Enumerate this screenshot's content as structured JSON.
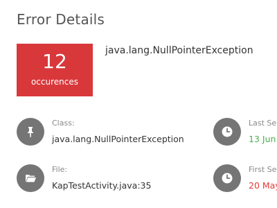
{
  "page": {
    "title": "Error Details"
  },
  "summary": {
    "count": "12",
    "count_label": "occurences",
    "exception": "java.lang.NullPointerException"
  },
  "details": {
    "class_label": "Class:",
    "class_value": "java.lang.NullPointerException",
    "file_label": "File:",
    "file_value": "KapTestActivity.java:35",
    "last_seen_label": "Last Se",
    "last_seen_value": "13 Jun",
    "first_seen_label": "First Se",
    "first_seen_value": "20 May"
  },
  "icons": {
    "class": "pin-icon",
    "file": "folder-icon",
    "last_seen": "clock-icon",
    "first_seen": "clock-icon"
  },
  "colors": {
    "counter_bg": "#d9383b",
    "icon_circle": "#757575",
    "last_seen": "#4caf50",
    "first_seen": "#e53935"
  }
}
